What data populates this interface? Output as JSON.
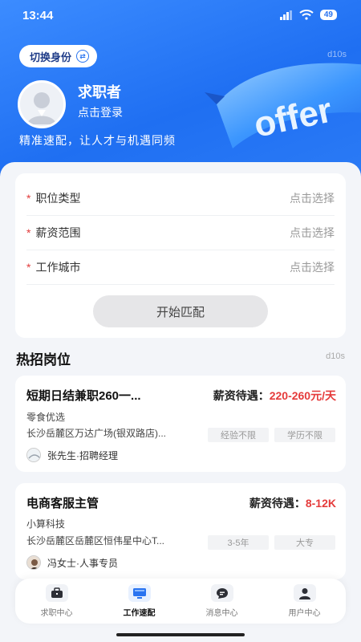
{
  "status": {
    "time": "13:44",
    "battery": "49"
  },
  "header": {
    "switch_label": "切换身份",
    "tag": "d10s",
    "user_name": "求职者",
    "login_link": "点击登录",
    "slogan": "精准速配，让人才与机遇同频",
    "ribbon_text": "offer"
  },
  "form": {
    "rows": [
      {
        "label": "职位类型",
        "value": "点击选择"
      },
      {
        "label": "薪资范围",
        "value": "点击选择"
      },
      {
        "label": "工作城市",
        "value": "点击选择"
      }
    ],
    "required_mark": "*",
    "match_button": "开始匹配"
  },
  "hot": {
    "title": "热招岗位",
    "tag": "d10s",
    "jobs": [
      {
        "title": "短期日结兼职260一...",
        "salary_label": "薪资待遇：",
        "salary_value": "220-260元/天",
        "company": "零食优选",
        "address": "长沙岳麓区万达广场(银双路店)...",
        "tags": [
          "经验不限",
          "学历不限"
        ],
        "recruiter": "张先生·招聘经理"
      },
      {
        "title": "电商客服主管",
        "salary_label": "薪资待遇：",
        "salary_value": "8-12K",
        "company": "小算科技",
        "address": "长沙岳麓区岳麓区恒伟星中心T...",
        "tags": [
          "3-5年",
          "大专"
        ],
        "recruiter": "冯女士·人事专员"
      }
    ]
  },
  "tabs": [
    {
      "label": "求职中心",
      "icon": "briefcase-icon"
    },
    {
      "label": "工作速配",
      "icon": "monitor-icon"
    },
    {
      "label": "消息中心",
      "icon": "chat-icon"
    },
    {
      "label": "用户中心",
      "icon": "user-icon"
    }
  ],
  "colors": {
    "primary": "#2a74f0",
    "salary": "#e53b3b",
    "required": "#e23c3c"
  }
}
